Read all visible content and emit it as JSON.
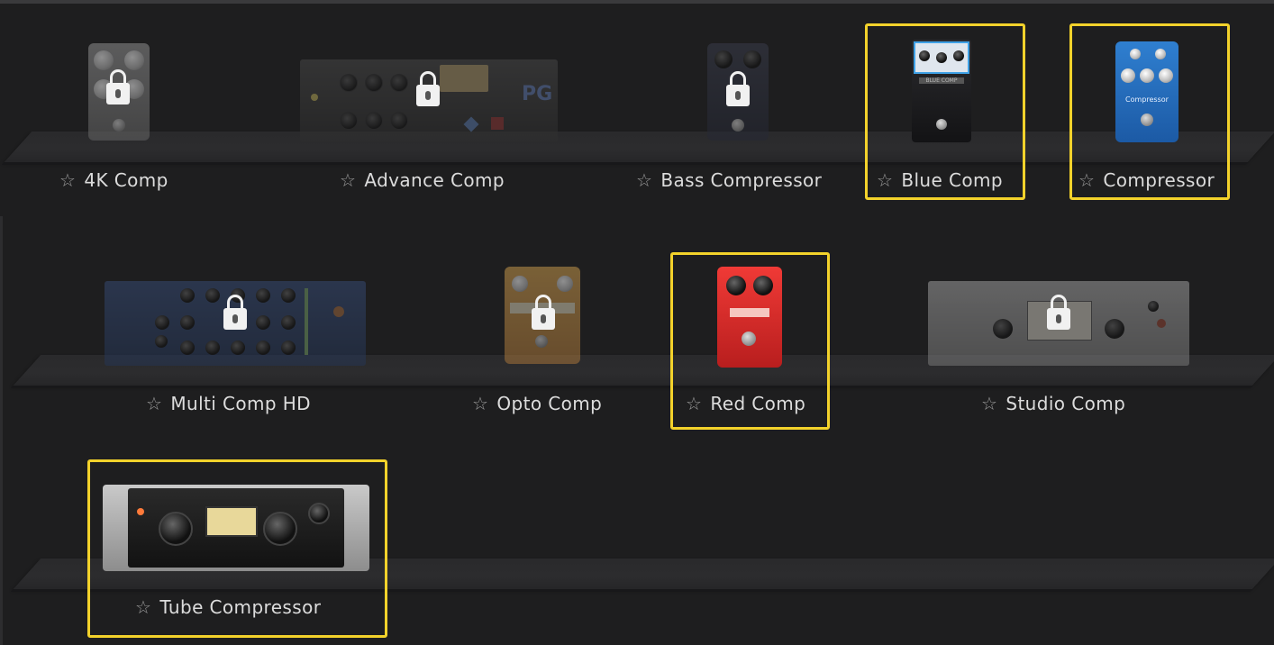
{
  "plugins": [
    {
      "id": "4k-comp",
      "name": "4K Comp",
      "locked": true,
      "highlighted": false
    },
    {
      "id": "advance-comp",
      "name": "Advance Comp",
      "locked": true,
      "highlighted": false,
      "badge": "PG"
    },
    {
      "id": "bass-compressor",
      "name": "Bass Compressor",
      "locked": true,
      "highlighted": false
    },
    {
      "id": "blue-comp",
      "name": "Blue Comp",
      "locked": false,
      "highlighted": true,
      "panel_text": "BLUE COMP"
    },
    {
      "id": "compressor",
      "name": "Compressor",
      "locked": false,
      "highlighted": true,
      "panel_text": "Compressor"
    },
    {
      "id": "multi-comp-hd",
      "name": "Multi Comp HD",
      "locked": true,
      "highlighted": false
    },
    {
      "id": "opto-comp",
      "name": "Opto Comp",
      "locked": true,
      "highlighted": false
    },
    {
      "id": "red-comp",
      "name": "Red Comp",
      "locked": false,
      "highlighted": true
    },
    {
      "id": "studio-comp",
      "name": "Studio Comp",
      "locked": true,
      "highlighted": false
    },
    {
      "id": "tube-compressor",
      "name": "Tube Compressor",
      "locked": false,
      "highlighted": true
    }
  ],
  "icons": {
    "favorite": "star-outline-icon",
    "lock": "padlock-icon"
  },
  "colors": {
    "background": "#1e1e1f",
    "highlight": "#f3d22b",
    "label": "#dcdcdc"
  }
}
